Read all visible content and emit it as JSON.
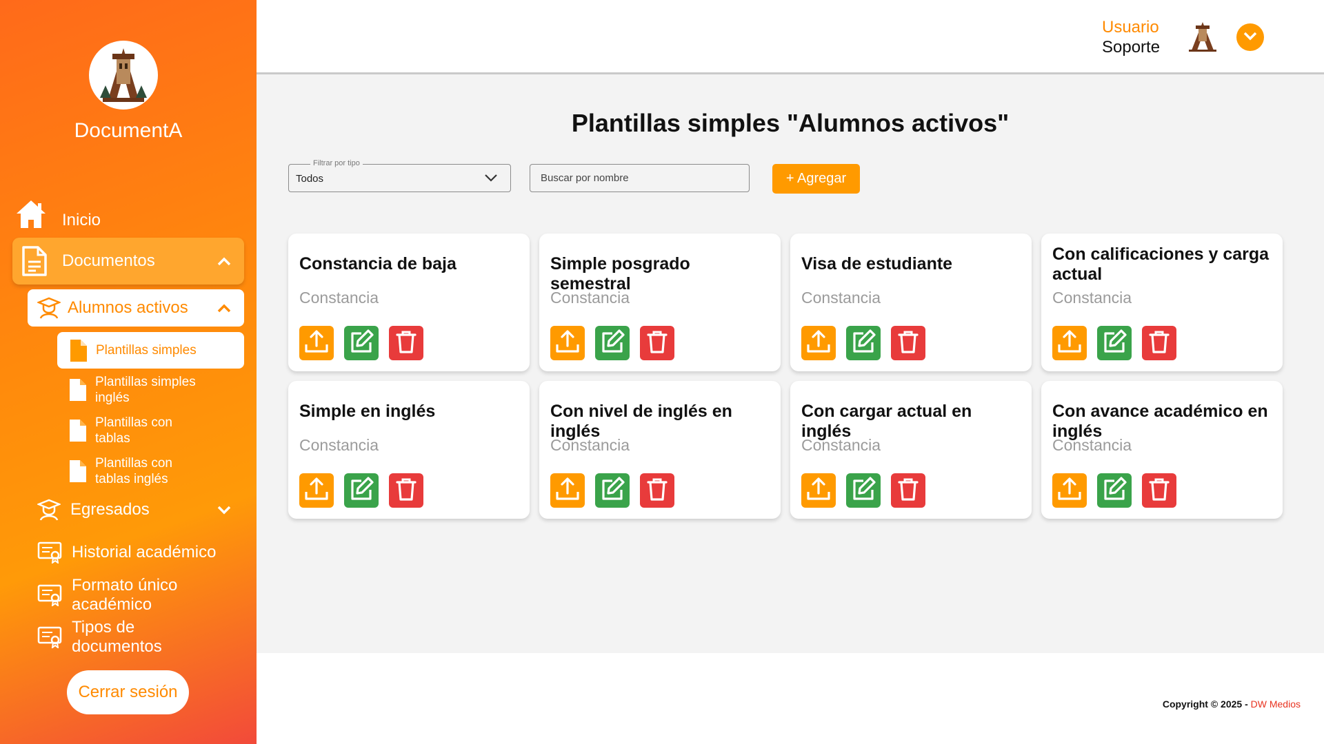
{
  "app": {
    "name": "DocumentA"
  },
  "colors": {
    "accent": "#ff9a00",
    "edit": "#3aa34a",
    "delete": "#e83b3b",
    "link": "#e8321f"
  },
  "sidebar": {
    "inicio": "Inicio",
    "documentos": "Documentos",
    "alumnos_activos": "Alumnos activos",
    "submenu": [
      "Plantillas simples",
      "Plantillas simples inglés",
      "Plantillas con tablas",
      "Plantillas con tablas inglés"
    ],
    "egresados": "Egresados",
    "historial": "Historial académico",
    "formato": "Formato único académico",
    "tipos": "Tipos de documentos",
    "logout": "Cerrar sesión"
  },
  "header": {
    "user_role": "Usuario",
    "user_name": "Soporte"
  },
  "main": {
    "title": "Plantillas simples \"Alumnos activos\"",
    "filter_label": "Filtrar por tipo",
    "filter_value": "Todos",
    "search_placeholder": "Buscar por nombre",
    "add_label": "+ Agregar"
  },
  "cards": [
    {
      "title": "Constancia de baja",
      "type": "Constancia"
    },
    {
      "title": "Simple posgrado semestral",
      "type": "Constancia"
    },
    {
      "title": "Visa de estudiante",
      "type": "Constancia"
    },
    {
      "title": "Con calificaciones y carga actual",
      "type": "Constancia"
    },
    {
      "title": "Simple en inglés",
      "type": "Constancia"
    },
    {
      "title": "Con nivel de inglés en inglés",
      "type": "Constancia"
    },
    {
      "title": "Con cargar actual en inglés",
      "type": "Constancia"
    },
    {
      "title": "Con avance académico en inglés",
      "type": "Constancia"
    }
  ],
  "footer": {
    "copyright": "Copyright © 2025 - ",
    "brand": "DW Medios"
  }
}
